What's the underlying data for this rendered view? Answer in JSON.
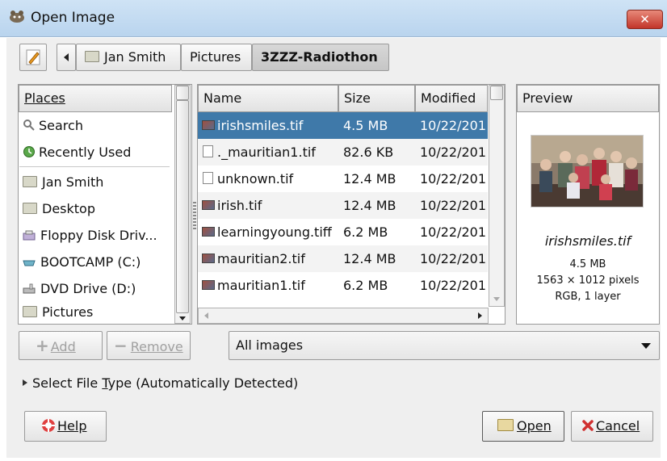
{
  "window": {
    "title": "Open Image",
    "close_label": "✕"
  },
  "path_bar": {
    "segments": [
      "Jan Smith",
      "Pictures",
      "3ZZZ-Radiothon"
    ]
  },
  "places": {
    "header": "Places",
    "items": [
      {
        "label": "Search",
        "icon": "search-icon"
      },
      {
        "label": "Recently Used",
        "icon": "recent-icon"
      },
      {
        "label": "Jan Smith",
        "icon": "folder-icon"
      },
      {
        "label": "Desktop",
        "icon": "folder-icon"
      },
      {
        "label": "Floppy Disk Driv...",
        "icon": "floppy-icon"
      },
      {
        "label": "BOOTCAMP (C:)",
        "icon": "drive-icon"
      },
      {
        "label": "DVD Drive (D:)",
        "icon": "dvd-icon"
      },
      {
        "label": "Pictures",
        "icon": "folder-icon"
      }
    ],
    "add_label": "Add",
    "remove_label": "Remove"
  },
  "files": {
    "columns": [
      "Name",
      "Size",
      "Modified"
    ],
    "rows": [
      {
        "name": "irishsmiles.tif",
        "size": "4.5 MB",
        "modified": "10/22/201",
        "selected": true,
        "icon": "image-icon"
      },
      {
        "name": "._mauritian1.tif",
        "size": "82.6 KB",
        "modified": "10/22/201",
        "selected": false,
        "icon": "document-icon"
      },
      {
        "name": "unknown.tif",
        "size": "12.4 MB",
        "modified": "10/22/201",
        "selected": false,
        "icon": "document-icon"
      },
      {
        "name": "irish.tif",
        "size": "12.4 MB",
        "modified": "10/22/201",
        "selected": false,
        "icon": "image-icon"
      },
      {
        "name": "learningyoung.tiff",
        "size": "6.2 MB",
        "modified": "10/22/201",
        "selected": false,
        "icon": "image-icon"
      },
      {
        "name": "mauritian2.tif",
        "size": "12.4 MB",
        "modified": "10/22/201",
        "selected": false,
        "icon": "image-icon"
      },
      {
        "name": "mauritian1.tif",
        "size": "6.2 MB",
        "modified": "10/22/201",
        "selected": false,
        "icon": "image-icon"
      }
    ]
  },
  "preview": {
    "header": "Preview",
    "filename": "irishsmiles.tif",
    "size": "4.5 MB",
    "dimensions": "1563 × 1012 pixels",
    "mode": "RGB, 1 layer"
  },
  "filter": {
    "selected": "All images"
  },
  "file_type": {
    "label_prefix": "Select File ",
    "label_accel": "T",
    "label_suffix": "ype (Automatically Detected)"
  },
  "buttons": {
    "help": "Help",
    "open": "Open",
    "cancel": "Cancel"
  },
  "colors": {
    "selection": "#3f79a9",
    "titlebar": "#c4dcf2",
    "close": "#c2352a"
  }
}
